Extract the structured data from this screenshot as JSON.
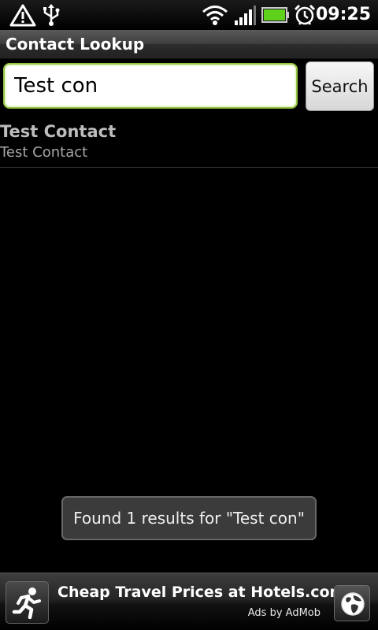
{
  "status_bar": {
    "time": "09:25",
    "icons": [
      "warning-icon",
      "usb-icon",
      "wifi-icon",
      "signal-icon",
      "battery-icon",
      "alarm-clock-icon"
    ],
    "battery_color": "#5fd11b"
  },
  "app": {
    "title": "Contact Lookup"
  },
  "search": {
    "value": "Test con",
    "button_label": "Search",
    "focus_color": "#93c543"
  },
  "results": [
    {
      "name": "Test Contact",
      "detail": "Test Contact"
    }
  ],
  "toast": {
    "message": "Found 1 results for \"Test con\""
  },
  "ad": {
    "headline": "Cheap Travel Prices at Hotels.com",
    "attribution": "Ads by AdMob",
    "icons": [
      "running-man-icon",
      "globe-icon"
    ]
  }
}
